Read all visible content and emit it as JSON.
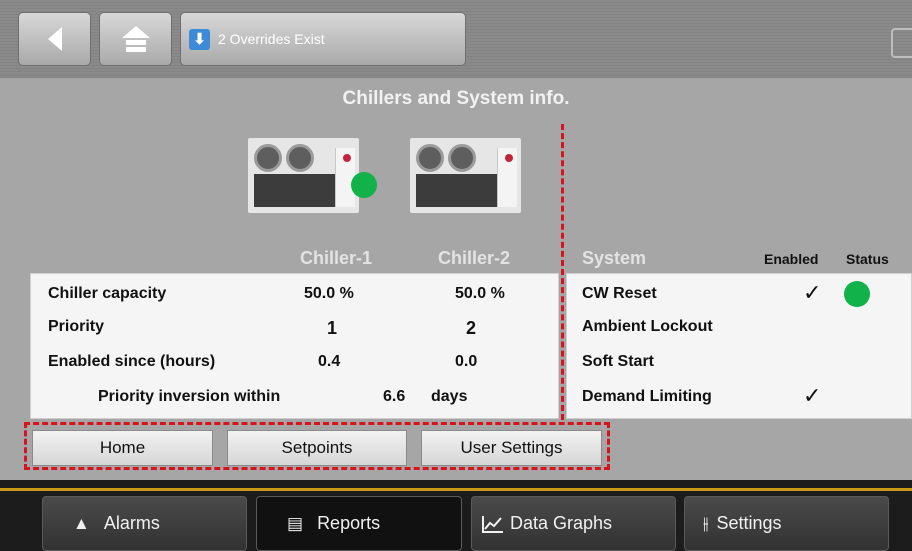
{
  "topbar": {
    "overrides_label": "2 Overrides Exist",
    "icons": [
      "back-arrow-icon",
      "home-icon",
      "download-arrow-icon"
    ]
  },
  "title": "Chillers and System info.",
  "chillers": [
    {
      "name": "Chiller-1",
      "capacity": "50.0 %",
      "priority": "1",
      "enabled_since": "0.4",
      "running": true
    },
    {
      "name": "Chiller-2",
      "capacity": "50.0 %",
      "priority": "2",
      "enabled_since": "0.0",
      "running": false
    }
  ],
  "rows": {
    "capacity_label": "Chiller capacity",
    "priority_label": "Priority",
    "enabled_label": "Enabled since (hours)",
    "inversion_label": "Priority inversion within",
    "inversion_value": "6.6",
    "inversion_unit": "days"
  },
  "system": {
    "header": "System",
    "enabled_header": "Enabled",
    "status_header": "Status",
    "items": [
      {
        "label": "CW Reset",
        "enabled": true,
        "status": "green"
      },
      {
        "label": "Ambient Lockout",
        "enabled": false,
        "status": null
      },
      {
        "label": "Soft Start",
        "enabled": false,
        "status": null
      },
      {
        "label": "Demand Limiting",
        "enabled": true,
        "status": null
      }
    ],
    "check_glyph": "✓"
  },
  "sub_nav": {
    "home": "Home",
    "setpoints": "Setpoints",
    "user_settings": "User Settings"
  },
  "bottom_nav": {
    "alarms": "Alarms",
    "reports": "Reports",
    "data_graphs": "Data Graphs",
    "settings": "Settings",
    "active": "Reports"
  },
  "colors": {
    "status_green": "#12b24a",
    "highlight_red": "#d7141d",
    "accent_yellow": "#c99a19"
  }
}
